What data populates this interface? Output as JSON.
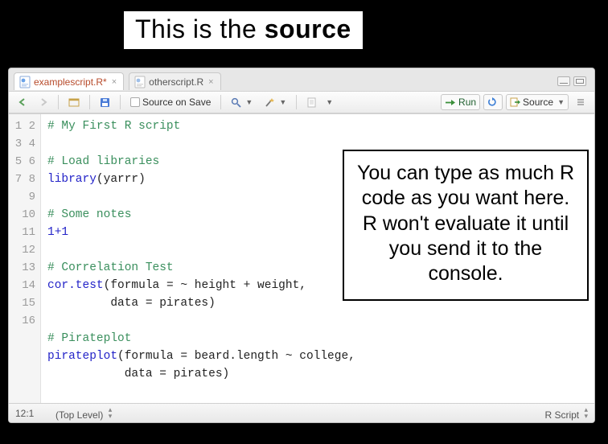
{
  "headline": {
    "pre": "This is the ",
    "bold": "source"
  },
  "tabs": {
    "active": {
      "filename": "examplescript.R*",
      "close": "×"
    },
    "other": {
      "filename": "otherscript.R",
      "close": "×"
    }
  },
  "toolbar": {
    "source_on_save": "Source on Save",
    "run": "Run",
    "source_btn": "Source"
  },
  "code": {
    "lines": [
      {
        "n": 1,
        "kind": "comment",
        "text": "# My First R script"
      },
      {
        "n": 2,
        "kind": "blank",
        "text": ""
      },
      {
        "n": 3,
        "kind": "comment",
        "text": "# Load libraries"
      },
      {
        "n": 4,
        "kind": "call",
        "fn": "library",
        "rest": "(yarrr)"
      },
      {
        "n": 5,
        "kind": "blank",
        "text": ""
      },
      {
        "n": 6,
        "kind": "comment",
        "text": "# Some notes"
      },
      {
        "n": 7,
        "kind": "expr",
        "text": "1+1"
      },
      {
        "n": 8,
        "kind": "blank",
        "text": ""
      },
      {
        "n": 9,
        "kind": "comment",
        "text": "# Correlation Test"
      },
      {
        "n": 10,
        "kind": "call",
        "fn": "cor.test",
        "rest": "(formula = ~ height + weight,"
      },
      {
        "n": 11,
        "kind": "plain",
        "text": "         data = pirates)"
      },
      {
        "n": 12,
        "kind": "blank",
        "text": ""
      },
      {
        "n": 13,
        "kind": "comment",
        "text": "# Pirateplot"
      },
      {
        "n": 14,
        "kind": "call",
        "fn": "pirateplot",
        "rest": "(formula = beard.length ~ college,"
      },
      {
        "n": 15,
        "kind": "plain",
        "text": "           data = pirates)"
      },
      {
        "n": 16,
        "kind": "blank",
        "text": ""
      }
    ]
  },
  "status": {
    "position": "12:1",
    "scope": "(Top Level)",
    "language": "R Script"
  },
  "callout": "You can type as much R code as you want here. R won't evaluate it until you send it to the console."
}
